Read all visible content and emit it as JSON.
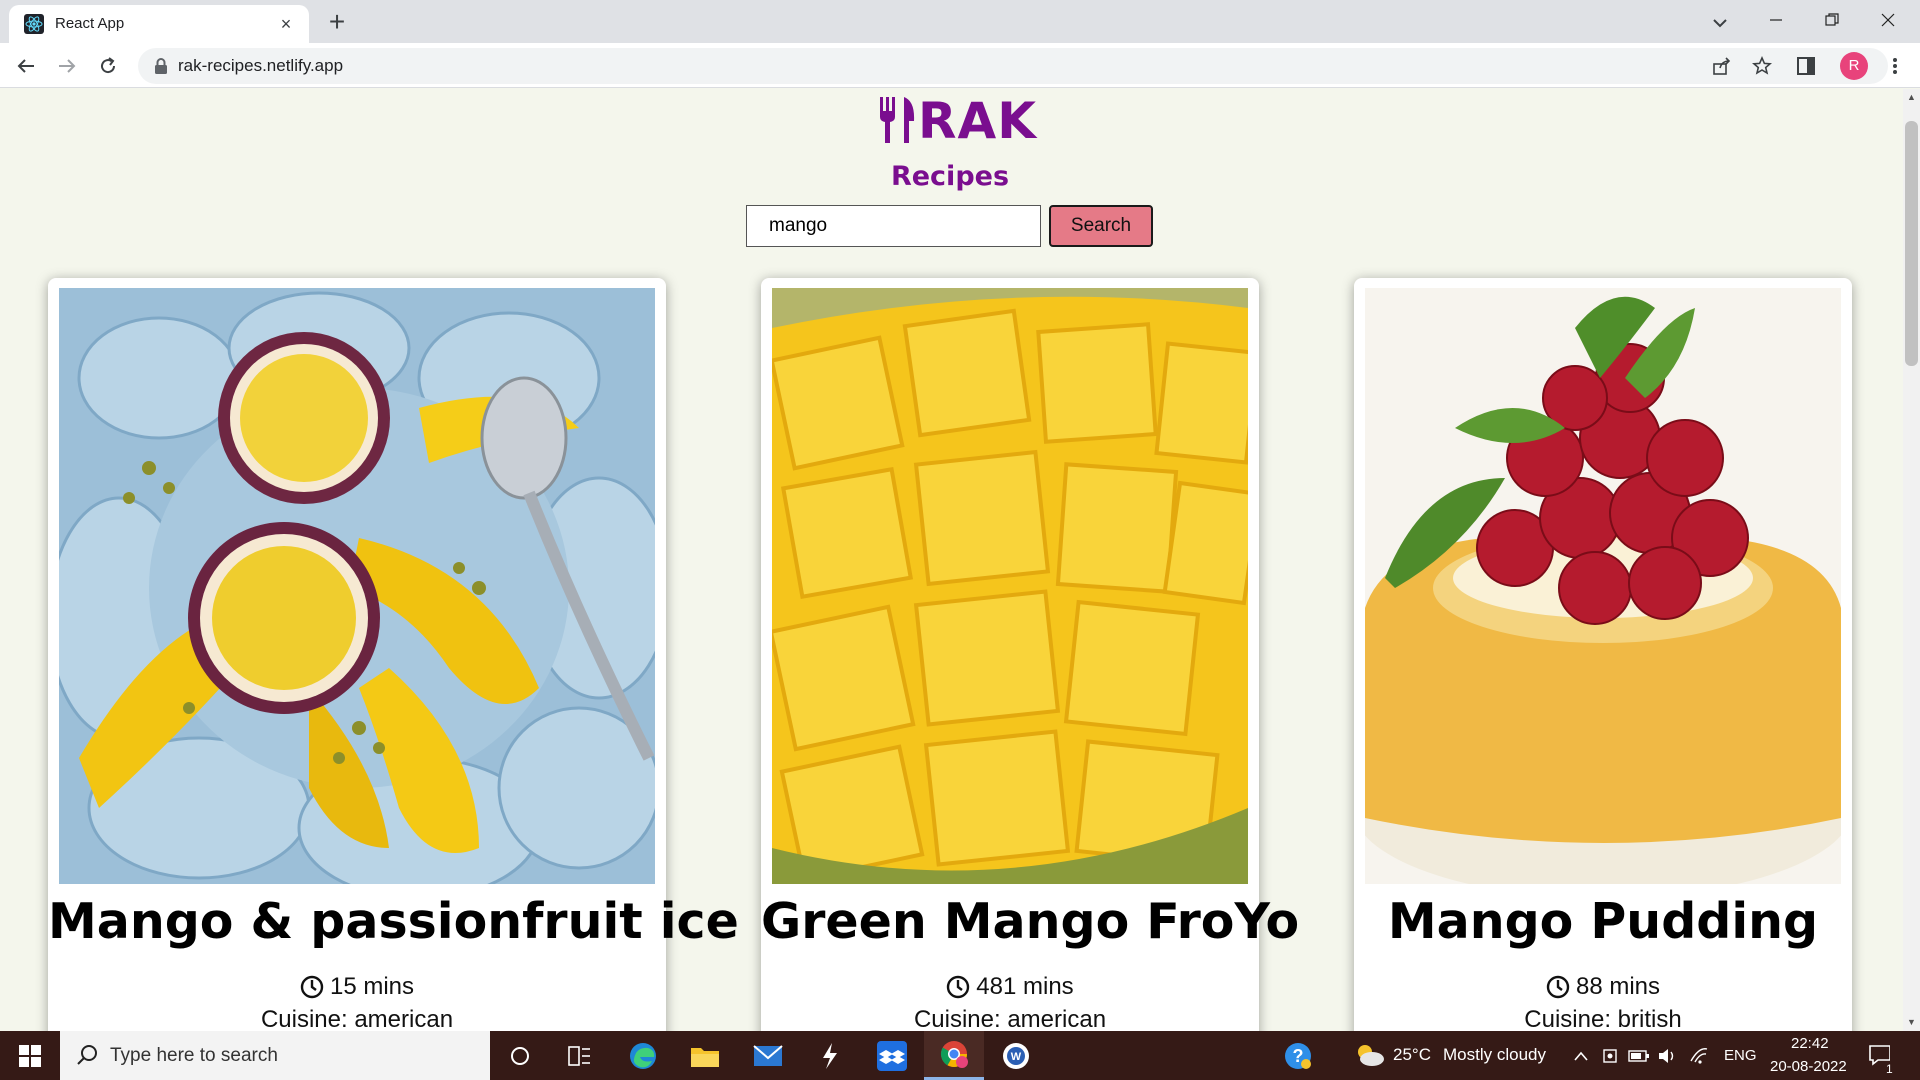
{
  "browser": {
    "tab_title": "React App",
    "tab_close": "×",
    "new_tab": "+",
    "url": "rak-recipes.netlify.app",
    "profile_initial": "R"
  },
  "site": {
    "logo_text": "RAK",
    "tagline": "Recipes",
    "search": {
      "value": "mango",
      "button_label": "Search"
    },
    "accent_color": "#7a0e8f",
    "button_color": "#e57a87"
  },
  "recipes": [
    {
      "title": "Mango & passionfruit ice",
      "time": "15 mins",
      "cuisine": "Cuisine: american",
      "image": "mango-passionfruit-ice-photo"
    },
    {
      "title": "Green Mango FroYo",
      "time": "481 mins",
      "cuisine": "Cuisine: american",
      "image": "sliced-mango-photo"
    },
    {
      "title": "Mango Pudding",
      "time": "88 mins",
      "cuisine": "Cuisine: british",
      "image": "mango-pudding-raspberries-photo"
    }
  ],
  "taskbar": {
    "search_placeholder": "Type here to search",
    "weather_temp": "25°C",
    "weather_desc": "Mostly cloudy",
    "language": "ENG",
    "time": "22:42",
    "date": "20-08-2022",
    "notification_count": "1"
  }
}
